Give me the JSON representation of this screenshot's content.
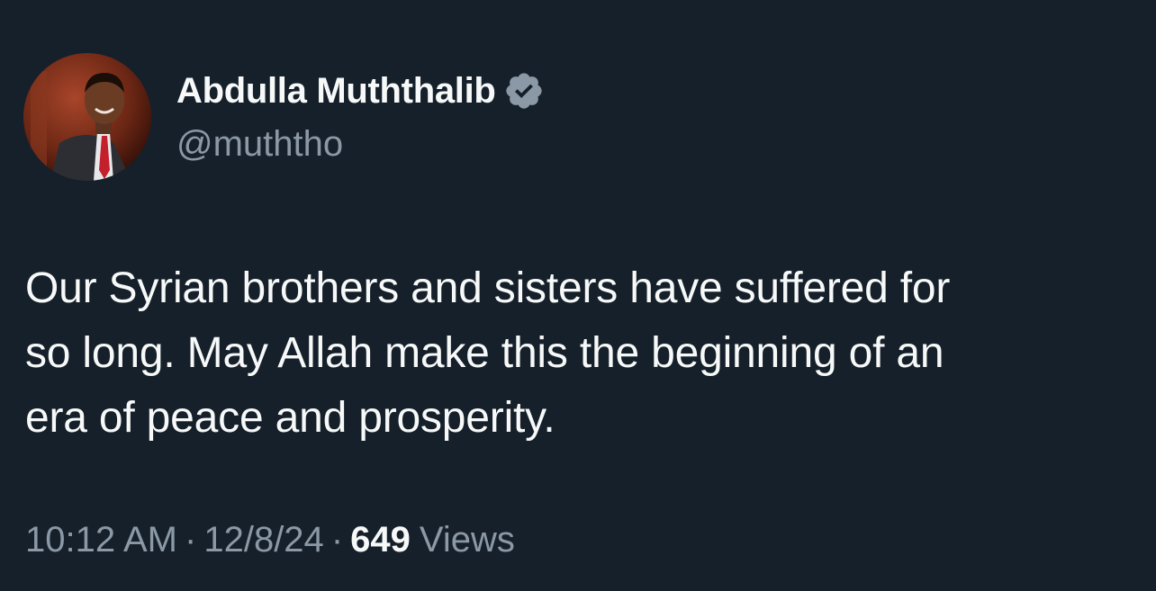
{
  "author": {
    "display_name": "Abdulla Muththalib",
    "handle": "@muththo",
    "verified": true,
    "avatar_icon": "profile-photo"
  },
  "tweet": {
    "text_lines": [
      "Our Syrian brothers and sisters have suffered for",
      "so long. May Allah make this the beginning of an",
      "era of peace and prosperity."
    ],
    "time": "10:12 AM",
    "date": "12/8/24",
    "separator": "·",
    "views_count": "649",
    "views_label": "Views"
  },
  "colors": {
    "background": "#16202a",
    "text_primary": "#f7f9f9",
    "text_secondary": "#8b98a5",
    "verified_badge": "#8b98a5"
  }
}
